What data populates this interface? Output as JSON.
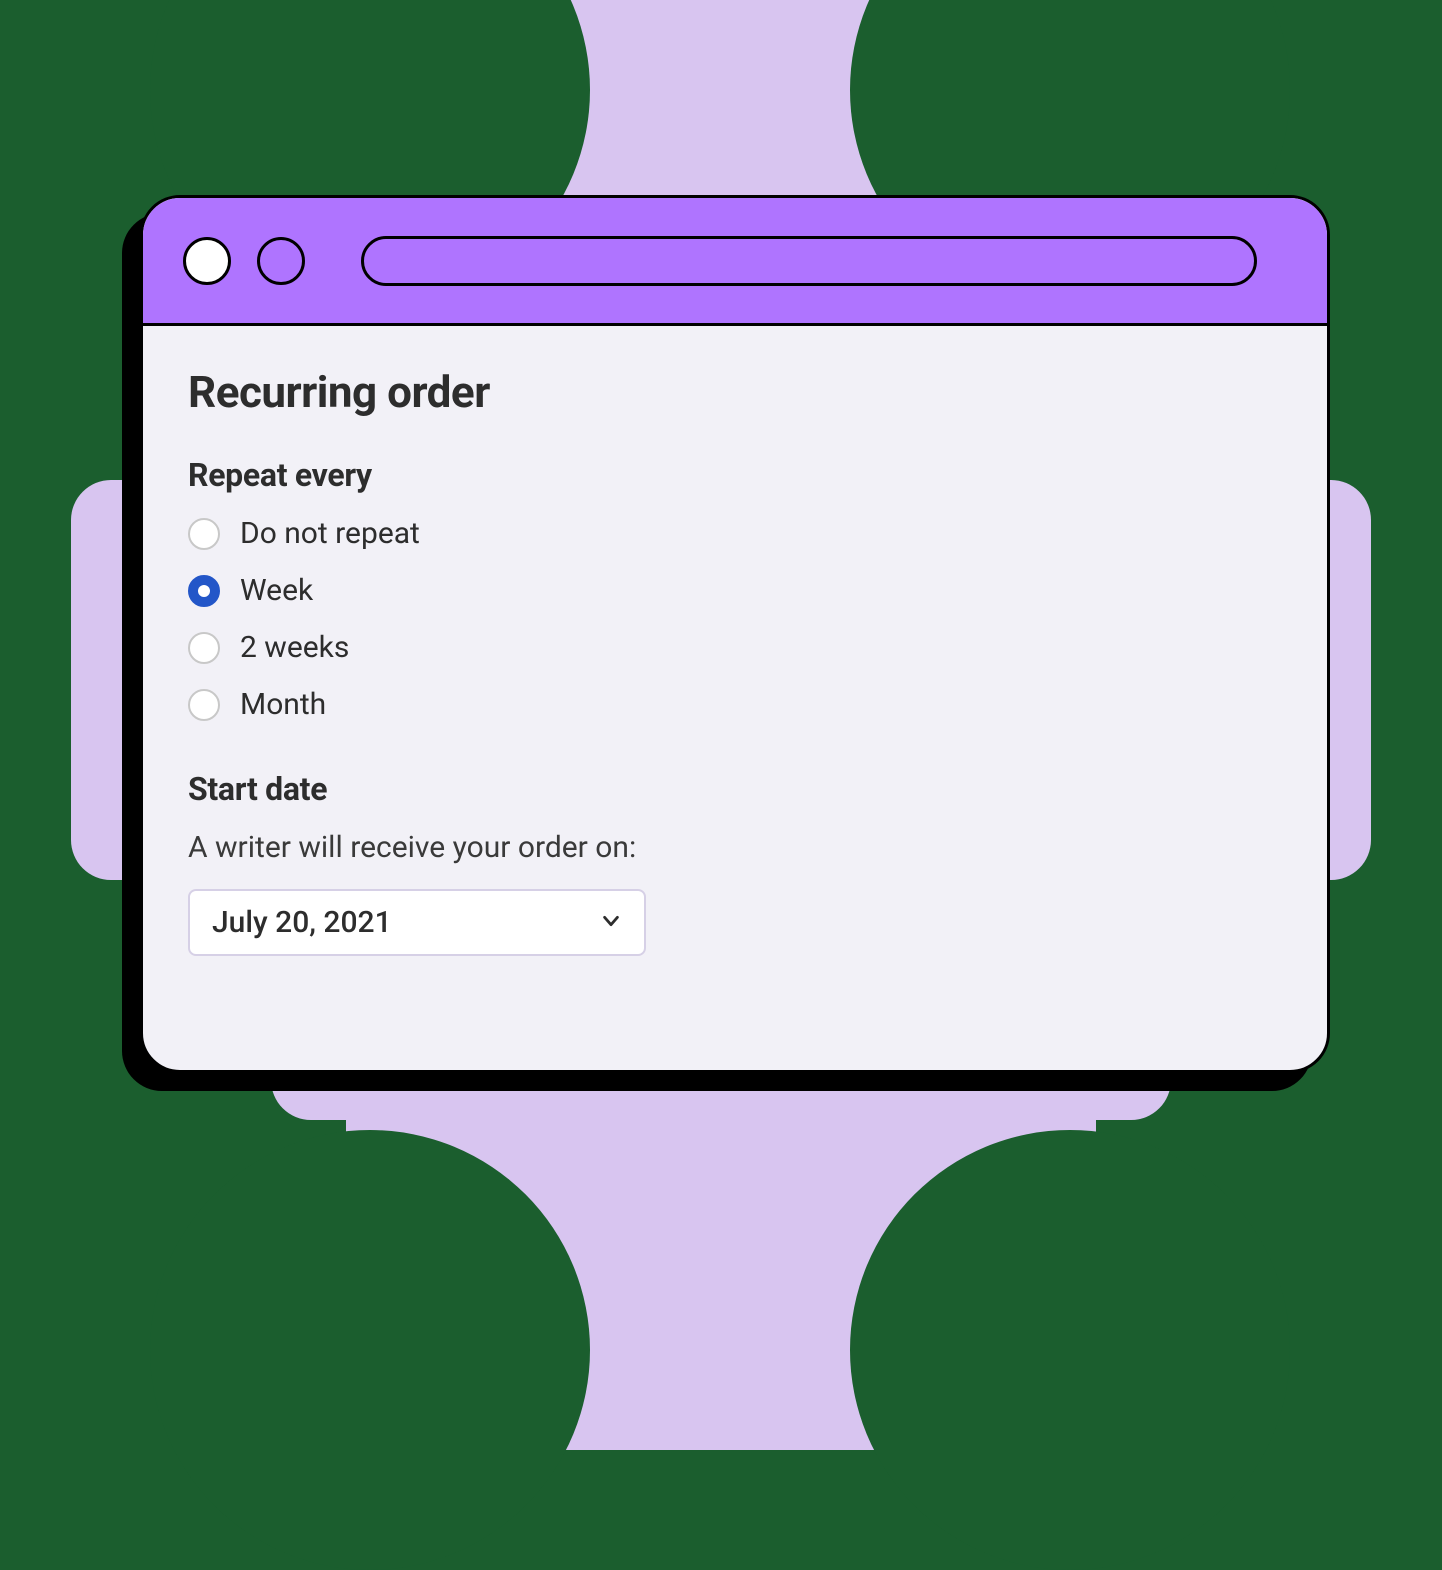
{
  "page": {
    "title": "Recurring order"
  },
  "repeat": {
    "label": "Repeat every",
    "options": [
      {
        "label": "Do not repeat",
        "selected": false
      },
      {
        "label": "Week",
        "selected": true
      },
      {
        "label": "2 weeks",
        "selected": false
      },
      {
        "label": "Month",
        "selected": false
      }
    ]
  },
  "start_date": {
    "label": "Start date",
    "help_text": "A writer will receive your order on:",
    "value": "July 20, 2021"
  },
  "colors": {
    "background": "#1b5e2e",
    "decorative_shape": "#d8c5f0",
    "titlebar": "#af74ff",
    "content_bg": "#f2f1f7",
    "radio_selected": "#2356c8",
    "text": "#2d2d2d"
  }
}
